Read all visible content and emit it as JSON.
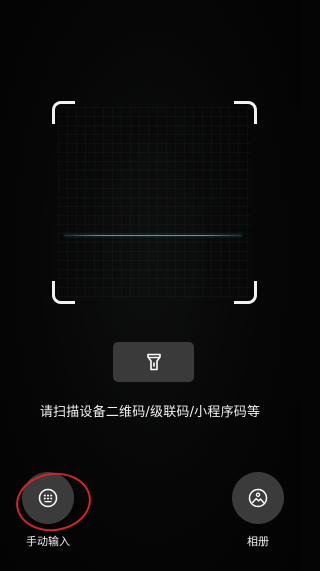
{
  "scanner": {
    "hint": "请扫描设备二维码/级联码/小程序码等",
    "scan_line_color": "#3aa3a3"
  },
  "flashlight": {
    "icon": "flashlight-icon"
  },
  "bottom_actions": {
    "manual_input": {
      "label": "手动输入",
      "icon": "keypad-icon"
    },
    "album": {
      "label": "相册",
      "icon": "gallery-icon"
    }
  },
  "annotation": {
    "highlight_color": "#d0252a"
  }
}
